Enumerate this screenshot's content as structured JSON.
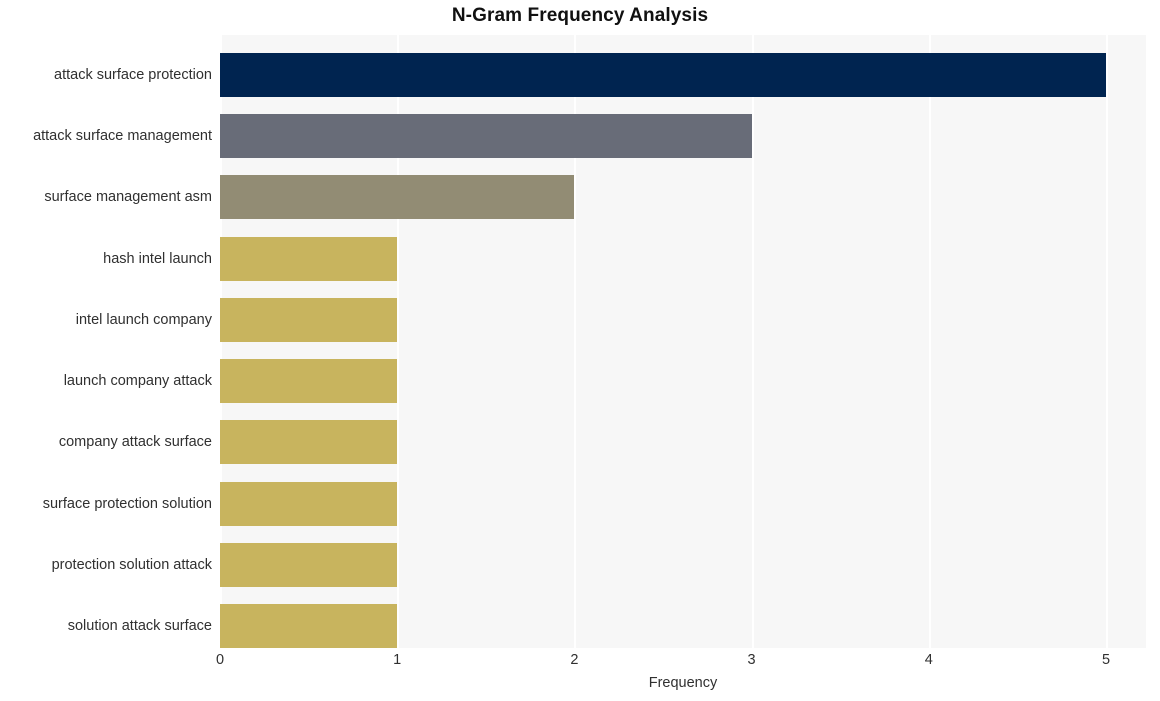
{
  "chart_data": {
    "type": "bar",
    "orientation": "horizontal",
    "title": "N-Gram Frequency Analysis",
    "xlabel": "Frequency",
    "ylabel": "",
    "xlim": [
      0,
      5
    ],
    "xticks": [
      "0",
      "1",
      "2",
      "3",
      "4",
      "5"
    ],
    "grid": "vertical",
    "legend": "none",
    "categories": [
      "attack surface protection",
      "attack surface management",
      "surface management asm",
      "hash intel launch",
      "intel launch company",
      "launch company attack",
      "company attack surface",
      "surface protection solution",
      "protection solution attack",
      "solution attack surface"
    ],
    "values": [
      5,
      3,
      2,
      1,
      1,
      1,
      1,
      1,
      1,
      1
    ],
    "bar_colors": [
      "#002450",
      "#686c78",
      "#928c74",
      "#c8b45e",
      "#c8b45e",
      "#c8b45e",
      "#c8b45e",
      "#c8b45e",
      "#c8b45e",
      "#c8b45e"
    ],
    "plot_background": "#f7f7f7",
    "gridline_color": "#ffffff",
    "figure_background": "#ffffff"
  }
}
